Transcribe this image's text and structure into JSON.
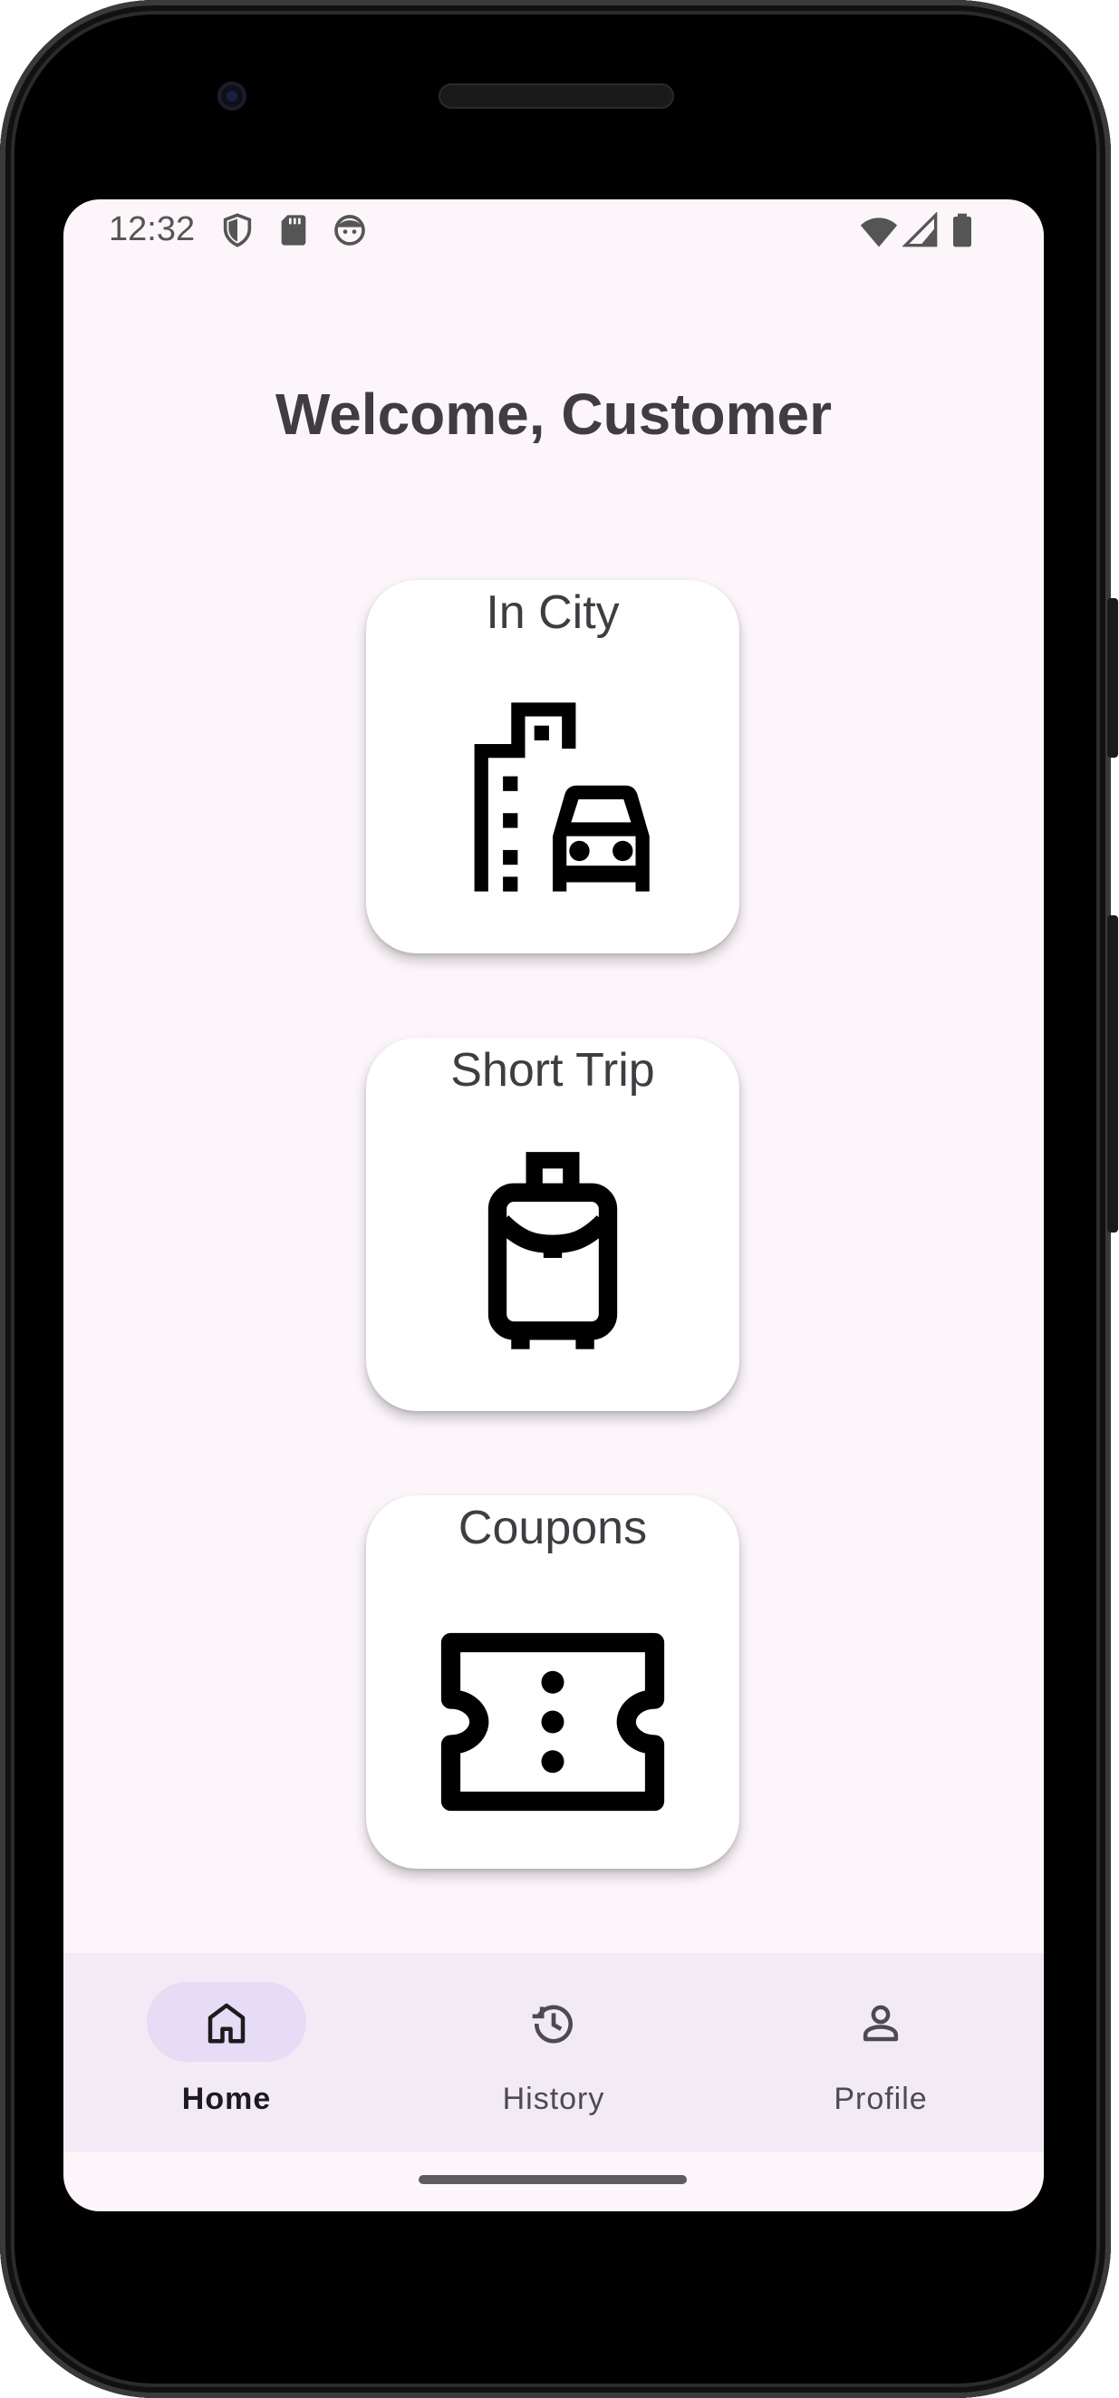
{
  "status_bar": {
    "time": "12:32",
    "left_icons": [
      "shield-icon",
      "sd-card-icon",
      "face-icon"
    ],
    "right_icons": [
      "wifi-icon",
      "signal-icon",
      "battery-icon"
    ]
  },
  "header": {
    "title": "Welcome, Customer"
  },
  "cards": [
    {
      "label": "In City",
      "icon": "city-car-icon"
    },
    {
      "label": "Short Trip",
      "icon": "luggage-icon"
    },
    {
      "label": "Coupons",
      "icon": "ticket-icon"
    }
  ],
  "bottom_nav": {
    "items": [
      {
        "label": "Home",
        "icon": "home-icon",
        "active": true
      },
      {
        "label": "History",
        "icon": "history-icon",
        "active": false
      },
      {
        "label": "Profile",
        "icon": "person-icon",
        "active": false
      }
    ]
  },
  "colors": {
    "screen_bg": "#fcf6fb",
    "nav_bg": "#f2ebf5",
    "active_pill": "#e6dcf5",
    "text_primary": "#3f3d42"
  }
}
